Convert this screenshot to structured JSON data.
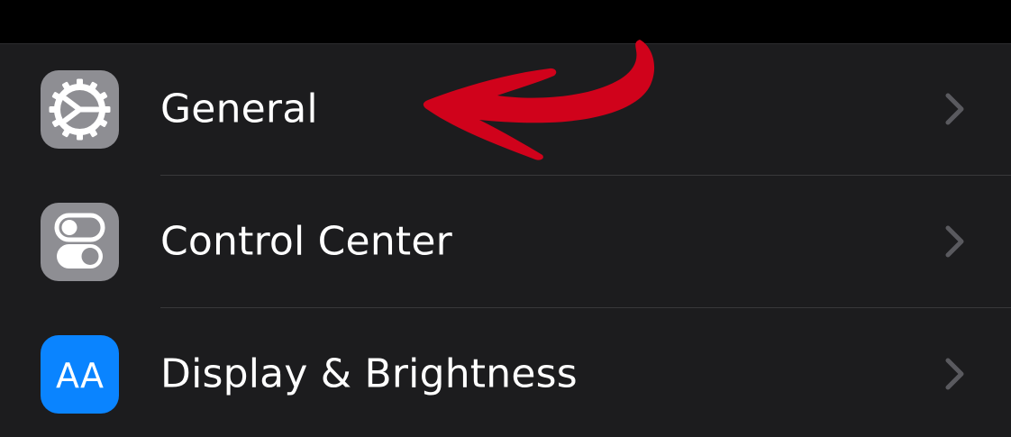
{
  "settings": {
    "items": [
      {
        "label": "General",
        "icon": "gear-icon",
        "icon_color": "#8e8e93"
      },
      {
        "label": "Control Center",
        "icon": "toggles-icon",
        "icon_color": "#8e8e93"
      },
      {
        "label": "Display & Brightness",
        "icon": "text-size-icon",
        "icon_color": "#0a84ff",
        "icon_text": "AA"
      }
    ]
  },
  "annotation": {
    "arrow_color": "#d0021b"
  }
}
